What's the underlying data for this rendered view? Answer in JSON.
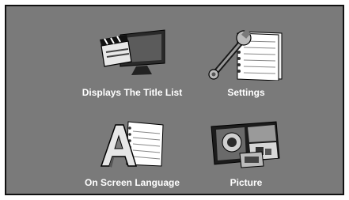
{
  "menu": {
    "items": [
      {
        "label": "Displays The Title List",
        "icon": "title-list-icon"
      },
      {
        "label": "Settings",
        "icon": "settings-icon"
      },
      {
        "label": "On Screen Language",
        "icon": "language-icon"
      },
      {
        "label": "Picture",
        "icon": "picture-icon"
      }
    ]
  },
  "colors": {
    "background": "#7a7a7a",
    "border": "#111111",
    "text": "#ffffff"
  }
}
